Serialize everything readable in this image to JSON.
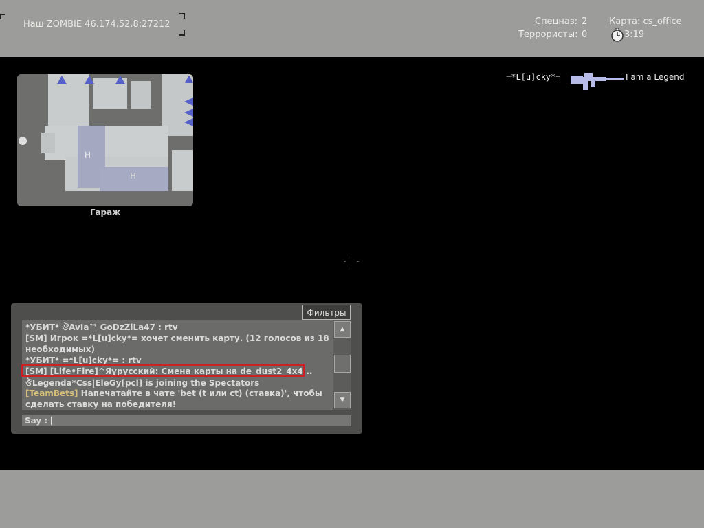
{
  "header": {
    "server_name": "Наш ZOMBIE 46.174.52.8:27212",
    "ct_label": "Спецназ:",
    "ct_score": "2",
    "t_label": "Террористы:",
    "t_score": "0",
    "map_label": "Карта: cs_office",
    "timer": "3:19"
  },
  "radar": {
    "location_label": "Гараж"
  },
  "killfeed": {
    "killer": "=*L[u]cky*=",
    "weapon_icon": "rifle-icon",
    "victim": "I am a Legend"
  },
  "chat": {
    "filters_label": "Фильтры",
    "lines": [
      "*УБИТ* ঔAvIa™ GoDzZiLa47 :  rtv",
      "[SM] Игрок =*L[u]cky*= хочет сменить карту. (12 голосов из 18",
      "необходимых)",
      "*УБИТ* =*L[u]cky*= :  rtv",
      "[SM] [Life•Fire]^Яурусский: Смена карты на de_dust2_4x4...",
      "ঔLegenda*Css|EleGy[pcl] is joining the Spectators",
      "Напечатайте в чате 'bet (t или ct) (ставка)', чтобы",
      "сделать ставку на победителя!"
    ],
    "teambets_tag": "[TeamBets]",
    "say_label": "Say :"
  },
  "colors": {
    "hud_bar": "#9c9d9a",
    "highlight": "#cc2222"
  }
}
